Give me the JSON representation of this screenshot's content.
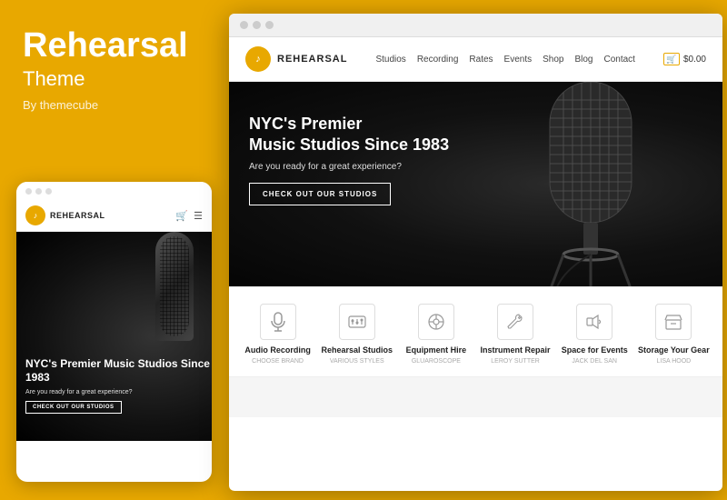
{
  "left": {
    "title": "Rehearsal",
    "subtitle": "Theme",
    "byline": "By themecube",
    "mobile": {
      "logo_text": "REHEARSAL",
      "hero_headline": "NYC's Premier Music Studios Since 1983",
      "hero_sub": "Are you ready for a great experience?",
      "cta_button": "CHECK OUT OUR STUDIOS"
    }
  },
  "browser": {
    "nav": {
      "logo_text": "REHEARSAL",
      "links": [
        "Studios",
        "Recording",
        "Rates",
        "Events",
        "Shop",
        "Blog",
        "Contact"
      ],
      "cart_amount": "$0.00"
    },
    "hero": {
      "headline_line1": "NYC's Premier",
      "headline_line2": "Music Studios Since 1983",
      "subheadline": "Are you ready for a great experience?",
      "cta_label": "CHECK OUT OUR STUDIOS"
    },
    "services": [
      {
        "name": "Audio Recording",
        "sub": "CHOOSE BRAND",
        "icon": "🎤"
      },
      {
        "name": "Rehearsal Studios",
        "sub": "VARIOUS STYLES",
        "icon": "🎛"
      },
      {
        "name": "Equipment Hire",
        "sub": "GLUAROSCOPE",
        "icon": "🎸"
      },
      {
        "name": "Instrument Repair",
        "sub": "LEROY SUTTER",
        "icon": "🔧"
      },
      {
        "name": "Space for Events",
        "sub": "JACK DEL SAN",
        "icon": "🔊"
      },
      {
        "name": "Storage Your Gear",
        "sub": "LISA HOOD",
        "icon": "📦"
      }
    ]
  }
}
